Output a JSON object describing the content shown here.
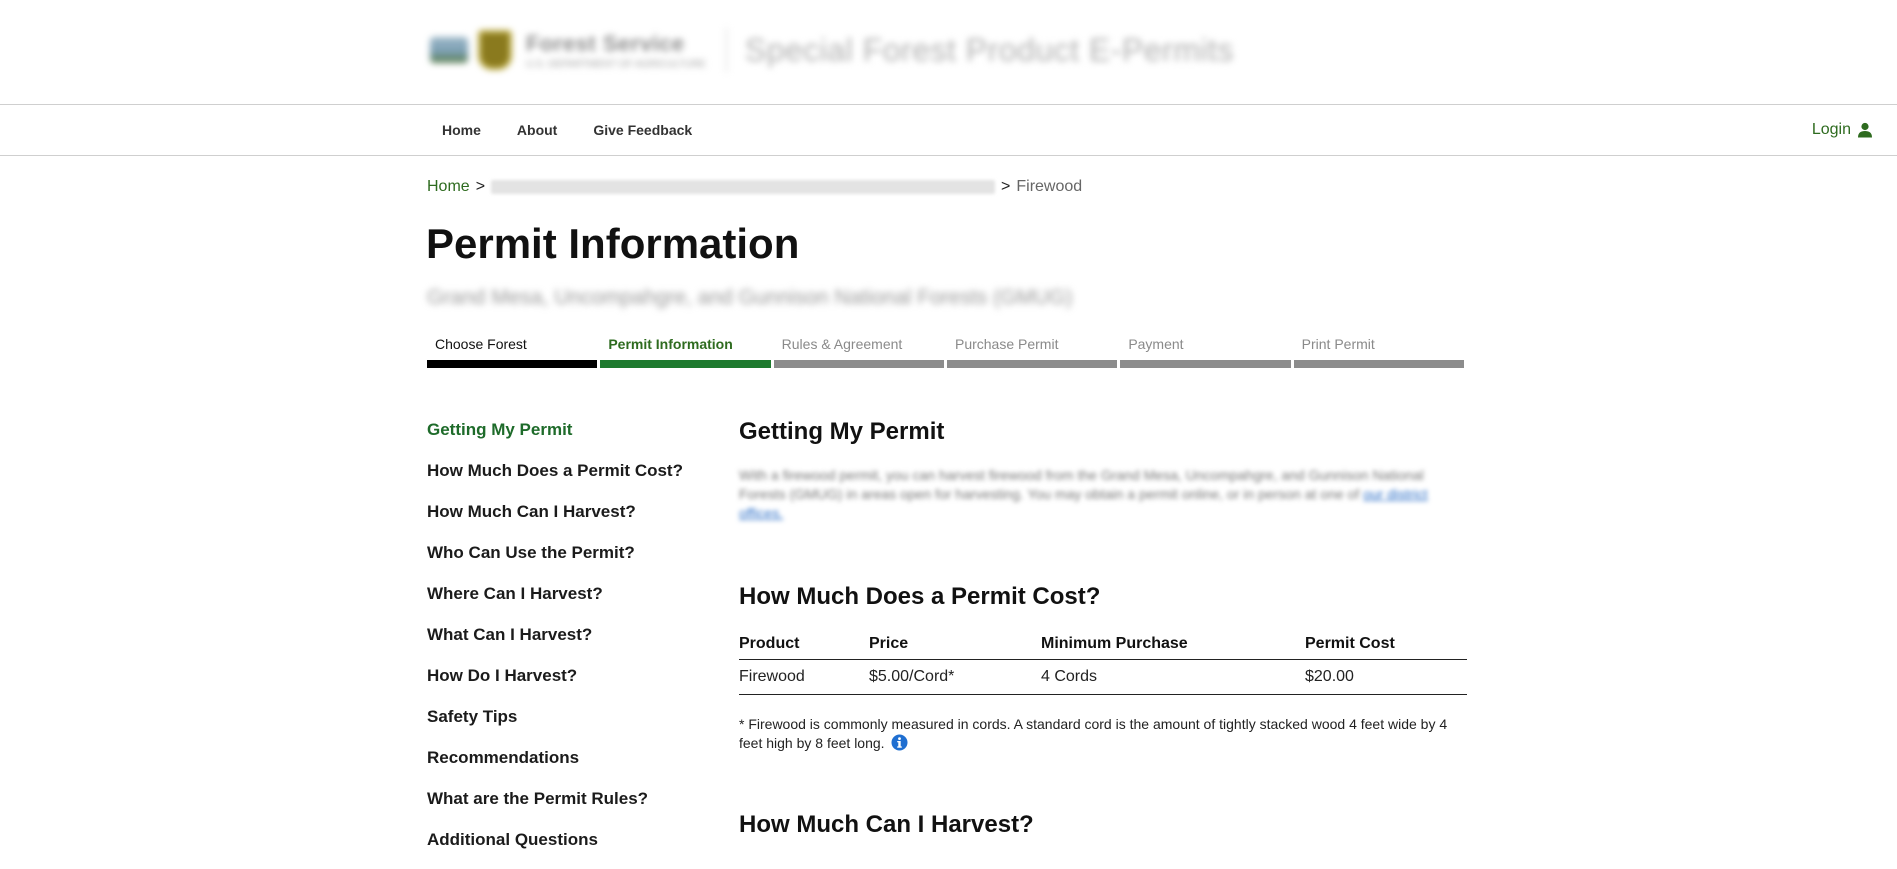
{
  "header": {
    "agency_line1": "Forest Service",
    "agency_line2": "U.S. DEPARTMENT OF AGRICULTURE",
    "app_title": "Special Forest Product E-Permits"
  },
  "nav": {
    "links": [
      "Home",
      "About",
      "Give Feedback"
    ],
    "login_label": "Login"
  },
  "breadcrumb": {
    "home": "Home",
    "separator": ">",
    "current": "Firewood"
  },
  "page": {
    "title": "Permit Information",
    "forest_subtitle": "Grand Mesa, Uncompahgre, and Gunnison National Forests (GMUG)"
  },
  "stepper": {
    "steps": [
      {
        "label": "Choose Forest",
        "state": "done"
      },
      {
        "label": "Permit Information",
        "state": "active"
      },
      {
        "label": "Rules & Agreement",
        "state": "pending"
      },
      {
        "label": "Purchase Permit",
        "state": "pending"
      },
      {
        "label": "Payment",
        "state": "pending"
      },
      {
        "label": "Print Permit",
        "state": "pending"
      }
    ]
  },
  "sidenav": {
    "items": [
      "Getting My Permit",
      "How Much Does a Permit Cost?",
      "How Much Can I Harvest?",
      "Who Can Use the Permit?",
      "Where Can I Harvest?",
      "What Can I Harvest?",
      "How Do I Harvest?",
      "Safety Tips",
      "Recommendations",
      "What are the Permit Rules?",
      "Additional Questions"
    ]
  },
  "sections": {
    "getting": {
      "heading": "Getting My Permit",
      "body": "With a firewood permit, you can harvest firewood from the Grand Mesa, Uncompahgre, and Gunnison National Forests (GMUG) in areas open for harvesting. You may obtain a permit online, or in person at one of",
      "link": "our district offices."
    },
    "cost": {
      "heading": "How Much Does a Permit Cost?",
      "columns": [
        "Product",
        "Price",
        "Minimum Purchase",
        "Permit Cost"
      ],
      "rows": [
        [
          "Firewood",
          "$5.00/Cord*",
          "4 Cords",
          "$20.00"
        ]
      ],
      "note": "* Firewood is commonly measured in cords. A standard cord is the amount of tightly stacked wood 4 feet wide by 4 feet high by 8 feet long."
    },
    "harvest": {
      "heading": "How Much Can I Harvest?"
    }
  },
  "colors": {
    "brand_green": "#2e6b1f",
    "step_active": "#1e7a2e",
    "step_done": "#000000",
    "step_pending": "#8c8c8c",
    "info_blue": "#1f6fd1"
  }
}
